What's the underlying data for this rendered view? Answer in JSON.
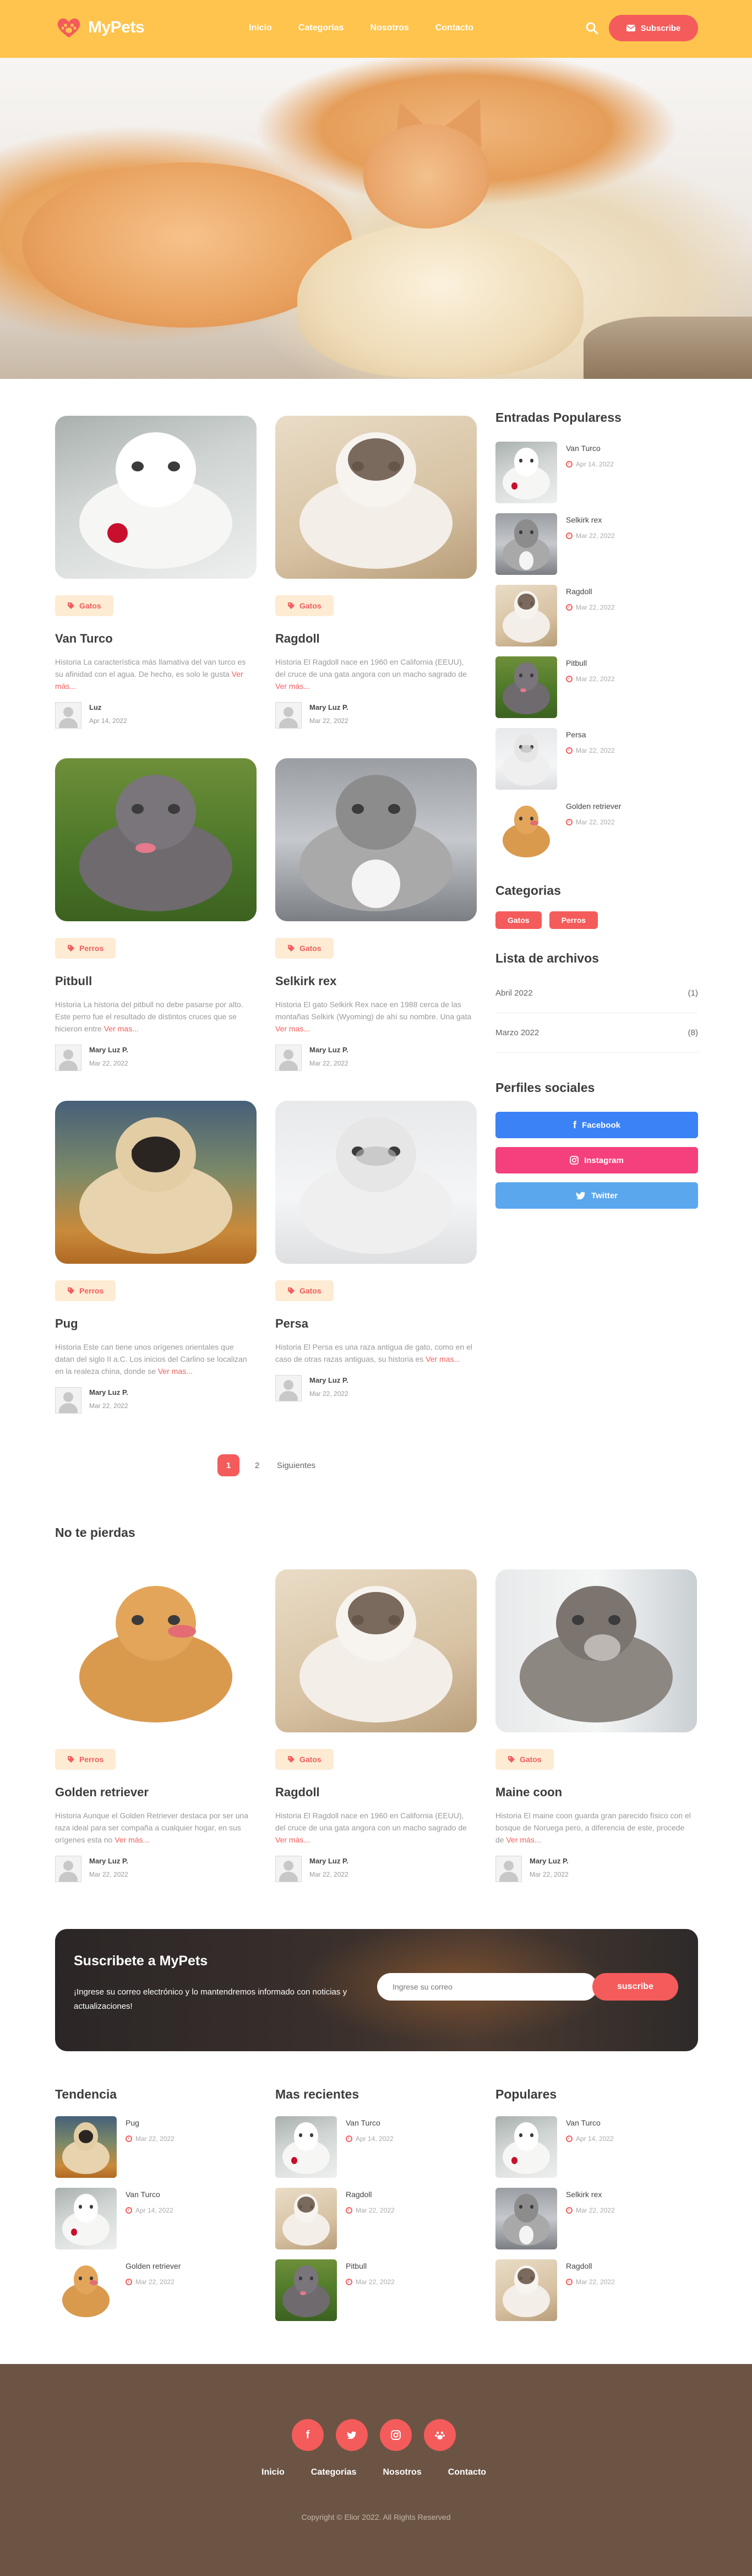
{
  "site": {
    "brand": "MyPets"
  },
  "nav": [
    "Inicio",
    "Categorias",
    "Nosotros",
    "Contacto"
  ],
  "header": {
    "subscribe_label": "Subscribe"
  },
  "posts": [
    {
      "tag": "Gatos",
      "title": "Van Turco",
      "excerpt": "Historia La característica más llamativa del van turco es su afinidad con el agua. De hecho, es solo le gusta",
      "more": "Ver más...",
      "author": "Luz",
      "date": "Apr 14, 2022",
      "img": "white-cat"
    },
    {
      "tag": "Gatos",
      "title": "Ragdoll",
      "excerpt": "Historia El Ragdoll nace en 1960 en California (EEUU), del cruce de una gata angora con un macho sagrado de",
      "more": "Ver más...",
      "author": "Mary Luz P.",
      "date": "Mar 22, 2022",
      "img": "ragdoll"
    },
    {
      "tag": "Perros",
      "title": "Pitbull",
      "excerpt": "Historia La historia del pitbull no debe pasarse por alto. Este perro fue el resultado de distintos cruces que se hicieron entre",
      "more": "Ver mas...",
      "author": "Mary Luz P.",
      "date": "Mar 22, 2022",
      "img": "pitbull"
    },
    {
      "tag": "Gatos",
      "title": "Selkirk rex",
      "excerpt": "Historia El gato Selkirk Rex nace en 1988 cerca de las montañas Selkirk (Wyoming) de ahí su nombre. Una gata",
      "more": "Ver mas...",
      "author": "Mary Luz P.",
      "date": "Mar 22, 2022",
      "img": "selkirk"
    },
    {
      "tag": "Perros",
      "title": "Pug",
      "excerpt": "Historia Este can tiene unos orígenes orientales que datan del siglo II a.C. Los inicios del Carlino se localizan en la realeza china, donde se",
      "more": "Ver mas...",
      "author": "Mary Luz P.",
      "date": "Mar 22, 2022",
      "img": "pug"
    },
    {
      "tag": "Gatos",
      "title": "Persa",
      "excerpt": "Historia El Persa es una raza antigua de gato, como en el caso de otras razas antiguas, su historia es",
      "more": "Ver mas...",
      "author": "Mary Luz P.",
      "date": "Mar 22, 2022",
      "img": "persa"
    }
  ],
  "sidebar": {
    "popular_title": "Entradas Popularess",
    "popular": [
      {
        "title": "Van Turco",
        "date": "Apr 14, 2022",
        "img": "white-cat"
      },
      {
        "title": "Selkirk rex",
        "date": "Mar 22, 2022",
        "img": "selkirk"
      },
      {
        "title": "Ragdoll",
        "date": "Mar 22, 2022",
        "img": "ragdoll"
      },
      {
        "title": "Pitbull",
        "date": "Mar 22, 2022",
        "img": "pitbull"
      },
      {
        "title": "Persa",
        "date": "Mar 22, 2022",
        "img": "persa"
      },
      {
        "title": "Golden retriever",
        "date": "Mar 22, 2022",
        "img": "golden"
      }
    ],
    "categories_title": "Categorias",
    "categories": [
      "Gatos",
      "Perros"
    ],
    "archive_title": "Lista de archivos",
    "archive": [
      {
        "month": "Abril 2022",
        "count": "(1)"
      },
      {
        "month": "Marzo 2022",
        "count": "(8)"
      }
    ],
    "social_title": "Perfiles sociales",
    "social": [
      {
        "label": "Facebook",
        "color": "#3b82f6"
      },
      {
        "label": "Instagram",
        "color": "#f4407c"
      },
      {
        "label": "Twitter",
        "color": "#5aa7ee"
      }
    ]
  },
  "pagination": {
    "current": "1",
    "next_page": "2",
    "next_label": "Siguientes"
  },
  "dont_miss": {
    "title": "No te pierdas",
    "posts": [
      {
        "tag": "Perros",
        "title": "Golden retriever",
        "excerpt": "Historia Aunque el Golden Retriever destaca por ser una raza ideal para ser compaña a cualquier hogar, en sus orígenes esta no",
        "more": "Ver más...",
        "author": "Mary Luz P.",
        "date": "Mar 22, 2022",
        "img": "golden"
      },
      {
        "tag": "Gatos",
        "title": "Ragdoll",
        "excerpt": "Historia El Ragdoll nace en 1960 en California (EEUU), del cruce de una gata angora con un macho sagrado de",
        "more": "Ver más...",
        "author": "Mary Luz P.",
        "date": "Mar 22, 2022",
        "img": "ragdoll"
      },
      {
        "tag": "Gatos",
        "title": "Maine coon",
        "excerpt": "Historia El maine coon guarda gran parecido físico con el bosque de Noruega pero, a diferencia de este, procede de",
        "more": "Ver más...",
        "author": "Mary Luz P.",
        "date": "Mar 22, 2022",
        "img": "maine"
      }
    ]
  },
  "newsletter": {
    "title": "Suscribete a MyPets",
    "text": "¡Ingrese su correo electrónico y lo mantendremos informado con noticias y actualizaciones!",
    "placeholder": "Ingrese su correo",
    "button": "suscribe"
  },
  "columns": [
    {
      "title": "Tendencia",
      "items": [
        {
          "title": "Pug",
          "date": "Mar 22, 2022",
          "img": "pug"
        },
        {
          "title": "Van Turco",
          "date": "Apr 14, 2022",
          "img": "white-cat"
        },
        {
          "title": "Golden retriever",
          "date": "Mar 22, 2022",
          "img": "golden"
        }
      ]
    },
    {
      "title": "Mas recientes",
      "items": [
        {
          "title": "Van Turco",
          "date": "Apr 14, 2022",
          "img": "white-cat"
        },
        {
          "title": "Ragdoll",
          "date": "Mar 22, 2022",
          "img": "ragdoll"
        },
        {
          "title": "Pitbull",
          "date": "Mar 22, 2022",
          "img": "pitbull"
        }
      ]
    },
    {
      "title": "Populares",
      "items": [
        {
          "title": "Van Turco",
          "date": "Apr 14, 2022",
          "img": "white-cat"
        },
        {
          "title": "Selkirk rex",
          "date": "Mar 22, 2022",
          "img": "selkirk"
        },
        {
          "title": "Ragdoll",
          "date": "Mar 22, 2022",
          "img": "ragdoll"
        }
      ]
    }
  ],
  "footer": {
    "social_icons": [
      "facebook-icon",
      "twitter-icon",
      "instagram-icon",
      "paw-icon"
    ],
    "nav": [
      "Inicio",
      "Categorias",
      "Nosotros",
      "Contacto"
    ],
    "copyright": "Copyright © Elior 2022. All Rights Reserved"
  },
  "colors": {
    "header": "#ffc44d",
    "accent": "#f45b5b",
    "footer": "#6b5444",
    "tag_bg": "#fdebd3"
  }
}
